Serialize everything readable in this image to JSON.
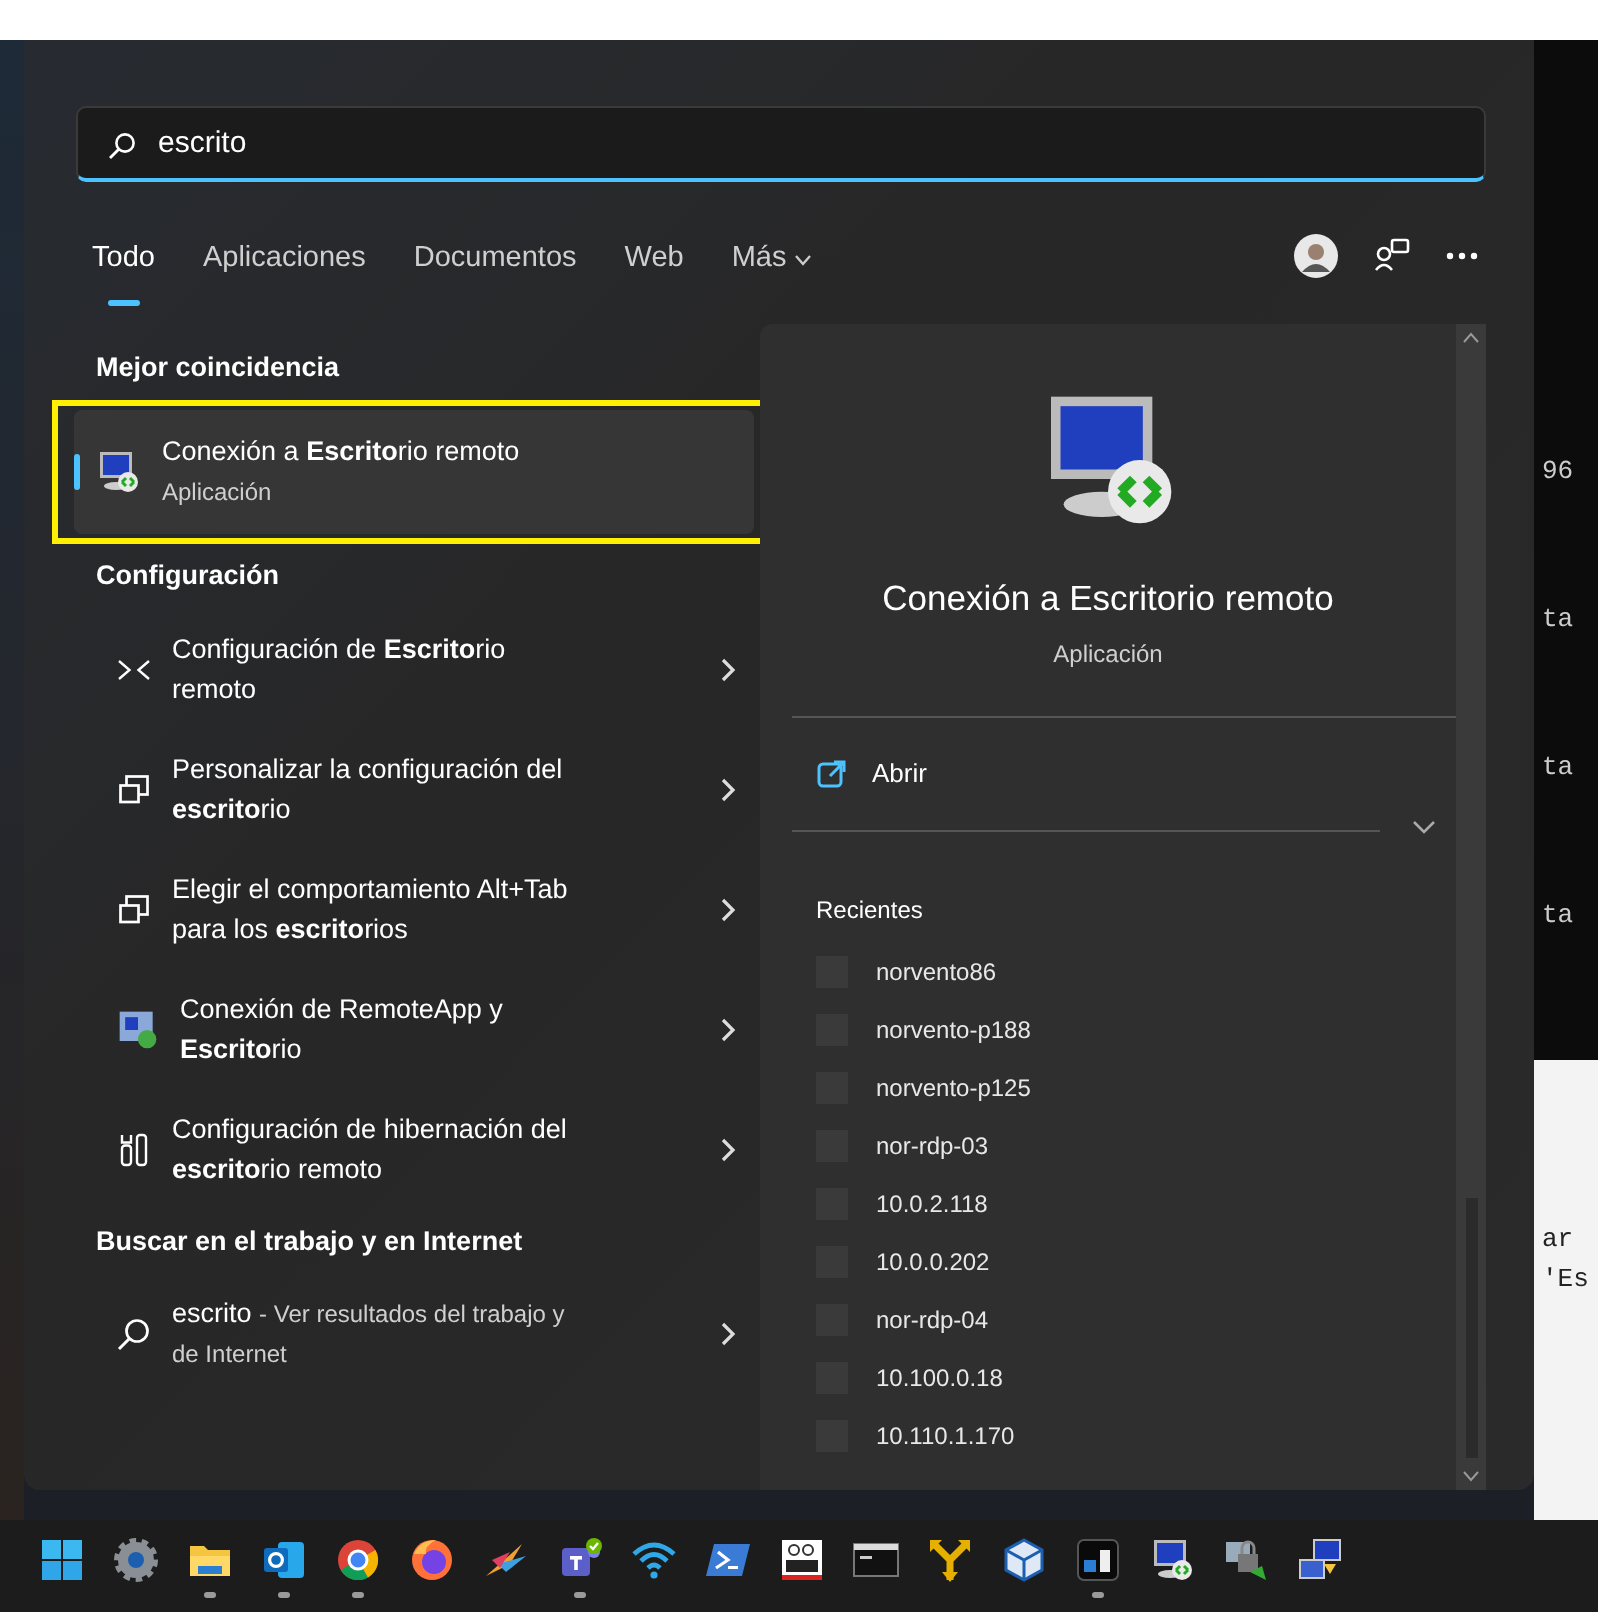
{
  "search": {
    "value": "escrito"
  },
  "tabs": [
    {
      "label": "Todo",
      "selected": true,
      "kind": "plain"
    },
    {
      "label": "Aplicaciones",
      "selected": false,
      "kind": "plain"
    },
    {
      "label": "Documentos",
      "selected": false,
      "kind": "plain"
    },
    {
      "label": "Web",
      "selected": false,
      "kind": "plain"
    },
    {
      "label": "Más",
      "selected": false,
      "kind": "dropdown"
    }
  ],
  "sections": [
    {
      "heading": "Mejor coincidencia",
      "items": [
        {
          "kind": "remote-desktop",
          "title": "Conexión a **Escrito**rio remoto",
          "subtitle": "Aplicación",
          "selected": true,
          "highlighted": true,
          "chevron": false
        }
      ]
    },
    {
      "heading": "Configuración",
      "items": [
        {
          "kind": "arrows",
          "title": "Configuración de **Escrito**rio remoto",
          "selected": false,
          "highlighted": false,
          "chevron": true
        },
        {
          "kind": "windows",
          "title": "Personalizar la configuración del **escrito**rio",
          "selected": false,
          "highlighted": false,
          "chevron": true
        },
        {
          "kind": "windows",
          "title": "Elegir el comportamiento Alt+Tab para los **escrito**rios",
          "selected": false,
          "highlighted": false,
          "chevron": true
        },
        {
          "kind": "remoteapp",
          "title": "Conexión de RemoteApp y **Escrito**rio",
          "selected": false,
          "highlighted": false,
          "chevron": true
        },
        {
          "kind": "tools",
          "title": "Configuración de hibernación del **escrito**rio remoto",
          "selected": false,
          "highlighted": false,
          "chevron": true
        }
      ]
    },
    {
      "heading": "Buscar en el trabajo y en Internet",
      "items": [
        {
          "kind": "search",
          "query": "escrito",
          "description": "- Ver resultados del trabajo y de Internet",
          "selected": false,
          "highlighted": false,
          "chevron": true
        }
      ]
    }
  ],
  "preview": {
    "title": "Conexión a Escritorio remoto",
    "subtitle": "Aplicación",
    "actions": [
      {
        "label": "Abrir"
      }
    ],
    "recent_heading": "Recientes",
    "recents": [
      "norvento86",
      "norvento-p188",
      "norvento-p125",
      "nor-rdp-03",
      "10.0.2.118",
      "10.0.0.202",
      "nor-rdp-04",
      "10.100.0.18",
      "10.110.1.170"
    ]
  },
  "background_fragments": [
    {
      "text": "96",
      "kind": "dark"
    },
    {
      "text": "ta",
      "kind": "dark"
    },
    {
      "text": "ta",
      "kind": "dark"
    },
    {
      "text": "ta",
      "kind": "dark"
    },
    {
      "text": "ar",
      "kind": "light"
    },
    {
      "text": "'Es",
      "kind": "light"
    }
  ],
  "taskbar": [
    {
      "kind": "start",
      "running": false
    },
    {
      "kind": "gear",
      "running": false
    },
    {
      "kind": "folder",
      "running": true
    },
    {
      "kind": "mail",
      "running": true
    },
    {
      "kind": "chrome",
      "running": true
    },
    {
      "kind": "firefox",
      "running": false
    },
    {
      "kind": "bird",
      "running": false
    },
    {
      "kind": "teams",
      "running": true
    },
    {
      "kind": "wifi",
      "running": false
    },
    {
      "kind": "shell",
      "running": false
    },
    {
      "kind": "vnc",
      "running": false
    },
    {
      "kind": "terminal",
      "running": false
    },
    {
      "kind": "yellow-arrows",
      "running": false
    },
    {
      "kind": "cube",
      "running": false
    },
    {
      "kind": "mr",
      "running": true
    },
    {
      "kind": "remote-desktop",
      "running": false
    },
    {
      "kind": "lock-network",
      "running": false
    },
    {
      "kind": "network",
      "running": false
    }
  ]
}
